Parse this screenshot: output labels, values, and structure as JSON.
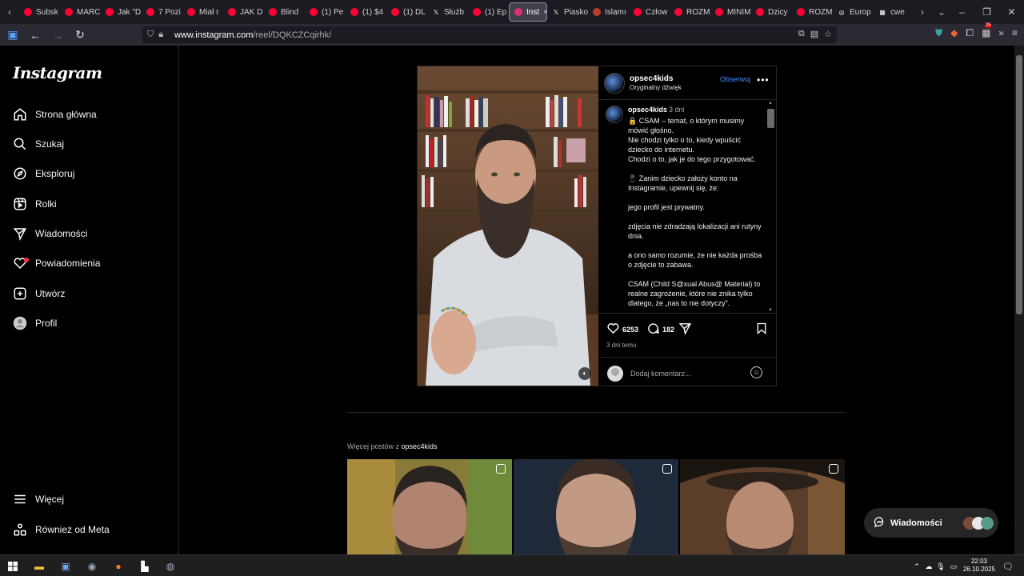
{
  "browser": {
    "tabs": [
      {
        "label": "Subsk",
        "color": "#ff0033"
      },
      {
        "label": "MARC",
        "color": "#ff0033"
      },
      {
        "label": "Jak \"D",
        "color": "#ff0033"
      },
      {
        "label": "7 Pozi",
        "color": "#ff0033"
      },
      {
        "label": "Miał r",
        "color": "#ff0033"
      },
      {
        "label": "JAK D",
        "color": "#ff0033"
      },
      {
        "label": "Blind",
        "color": "#ff0033"
      },
      {
        "label": "(1) Pe",
        "color": "#ff0033"
      },
      {
        "label": "(1) $4",
        "color": "#ff0033"
      },
      {
        "label": "(1) DL",
        "color": "#ff0033"
      },
      {
        "label": "Służb",
        "color": "#000000",
        "icon": "x-icon"
      },
      {
        "label": "(1) Ep",
        "color": "#ff0033"
      },
      {
        "label": "Inst",
        "color": "#e1306c",
        "active": true
      },
      {
        "label": "Piasko",
        "color": "#000000",
        "icon": "x-icon"
      },
      {
        "label": "Islamı",
        "color": "#c0392b"
      },
      {
        "label": "Człow",
        "color": "#ff0033"
      },
      {
        "label": "ROZM",
        "color": "#ff0033"
      },
      {
        "label": "MINIM",
        "color": "#ff0033"
      },
      {
        "label": "Dzicy",
        "color": "#ff0033"
      },
      {
        "label": "ROZM",
        "color": "#ff0033"
      },
      {
        "label": "Europ",
        "color": "#888888",
        "icon": "globe-icon"
      },
      {
        "label": "cwe",
        "color": "#888888",
        "icon": "grid-icon"
      }
    ],
    "tab_close": "×",
    "url_host": "www.instagram.com",
    "url_path": "/reel/DQKCZCqirhk/",
    "ext_badge": "25"
  },
  "sidebar": {
    "logo": "Instagram",
    "items": [
      {
        "label": "Strona główna",
        "icon": "home-icon"
      },
      {
        "label": "Szukaj",
        "icon": "search-icon"
      },
      {
        "label": "Eksploruj",
        "icon": "compass-icon"
      },
      {
        "label": "Rolki",
        "icon": "reels-icon"
      },
      {
        "label": "Wiadomości",
        "icon": "send-icon"
      },
      {
        "label": "Powiadomienia",
        "icon": "heart-icon"
      },
      {
        "label": "Utwórz",
        "icon": "plus-icon"
      },
      {
        "label": "Profil",
        "icon": "avatar-icon"
      }
    ],
    "more": "Więcej",
    "meta": "Również od Meta"
  },
  "post": {
    "username": "opsec4kids",
    "audio": "Oryginalny dźwięk",
    "follow": "Obserwuj",
    "caption_user": "opsec4kids",
    "caption_time": "3 dni",
    "caption_lines": [
      "🔒 CSAM – temat, o którym musimy mówić głośno.",
      "Nie chodzi tylko o to, kiedy wpuścić dziecko do internetu.",
      "Chodzi o to, jak je do tego przygotować.",
      "",
      "📱 Zanim dziecko założy konto na Instagramie, upewnij się, że:",
      "",
      "jego profil jest prywatny.",
      "",
      "zdjęcia nie zdradzają lokalizacji ani rutyny dnia.",
      "",
      "a ono samo rozumie, że nie każda prośba o zdjęcie to zabawa.",
      "",
      "CSAM (Child S@xual Abus@ Material) to realne zagrożenie, które nie znika tylko dlatego, że „nas to nie dotyczy”."
    ],
    "likes": "6253",
    "comments": "182",
    "posted_ago": "3 dni temu",
    "comment_placeholder": "Dodaj komentarz..."
  },
  "more_posts": {
    "prefix": "Więcej postów z ",
    "user": "opsec4kids"
  },
  "messages_button": "Wiadomości",
  "taskbar": {
    "time": "22:03",
    "date": "26.10.2025"
  }
}
